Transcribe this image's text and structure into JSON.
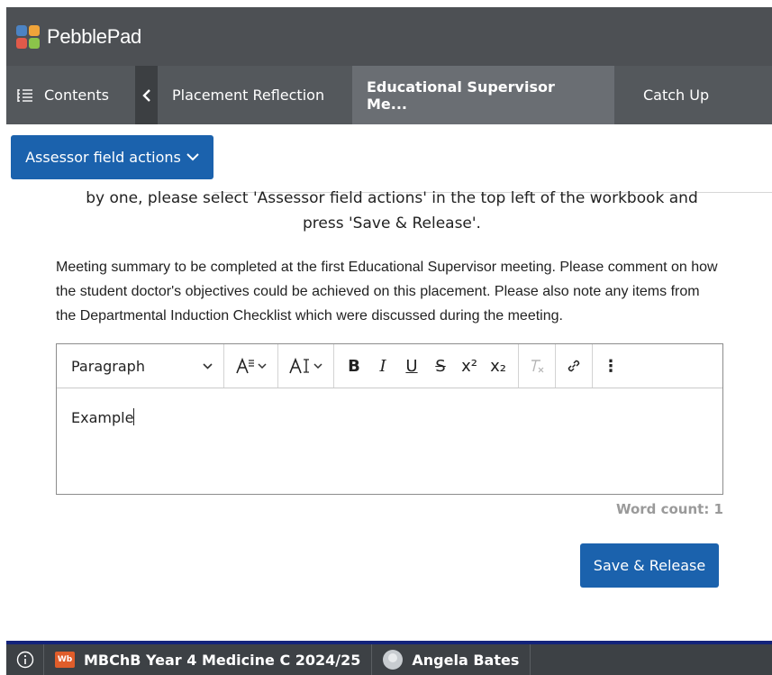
{
  "app": {
    "name": "PebblePad"
  },
  "tabbar": {
    "contents_label": "Contents",
    "tabs": [
      {
        "label": "Placement Reflection",
        "active": false
      },
      {
        "label": "Educational Supervisor Me...",
        "active": true
      },
      {
        "label": "Catch Up",
        "active": false
      }
    ]
  },
  "assessor": {
    "label": "Assessor field actions"
  },
  "instructions": {
    "line1": "by one, please select 'Assessor field actions' in the top left of the workbook and",
    "line2": "press 'Save & Release'."
  },
  "summary": {
    "text": "Meeting summary to be completed at the first Educational Supervisor meeting. Please comment on how the student doctor's objectives could be achieved on this placement. Please also note any items from the Departmental Induction Checklist which were discussed during the meeting."
  },
  "editor": {
    "block_format": "Paragraph",
    "content": "Example",
    "toolbar": {
      "bold": "B",
      "italic": "I",
      "underline": "U",
      "strike": "S",
      "superscript": "x²",
      "subscript": "x₂",
      "more": "⋮"
    }
  },
  "wordcount": {
    "label": "Word count: 1"
  },
  "save": {
    "label": "Save & Release"
  },
  "bottombar": {
    "workbook_badge": "Wb",
    "workbook_title": "MBChB Year 4 Medicine C 2024/25",
    "user_name": "Angela Bates"
  },
  "colors": {
    "primary": "#1b62ad",
    "appbar": "#4d5054",
    "tabbar": "#54585c",
    "active_tab": "#6a6e73",
    "bottom_accent": "#13237a",
    "workbook_badge": "#e05d2a"
  }
}
